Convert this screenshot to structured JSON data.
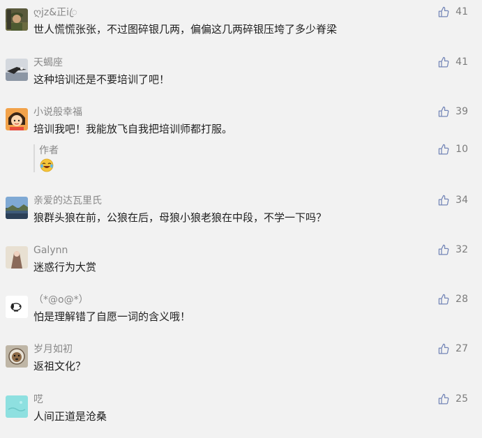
{
  "comments": [
    {
      "name": "ღjz&正iꦿ",
      "text": "世人慌慌张张，不过图碎银几两，偏偏这几两碎银压垮了多少脊梁",
      "likes": "41",
      "avatar": "soldier-avatar"
    },
    {
      "name": "天蝎座",
      "text": "这种培训还是不要培训了吧！",
      "likes": "41",
      "avatar": "eagle-avatar"
    },
    {
      "name": "小说般幸福",
      "text": "培训我吧！我能放飞自我把培训师都打服。",
      "likes": "39",
      "avatar": "cartoon-girl-avatar"
    },
    {
      "name": "亲爱的达瓦里氏",
      "text": "狼群头狼在前，公狼在后，母狼小狼老狼在中段，不学一下吗？",
      "likes": "34",
      "avatar": "landscape-avatar"
    },
    {
      "name": "Galynn",
      "text": "迷惑行为大赏",
      "likes": "32",
      "avatar": "figure-avatar"
    },
    {
      "name": "（*@o@*）",
      "text": "怕是理解错了自愿一词的含义哦！",
      "likes": "28",
      "avatar": "snoopy-avatar"
    },
    {
      "name": "岁月如初",
      "text": "返祖文化？",
      "likes": "27",
      "avatar": "dog-avatar"
    },
    {
      "name": "呓",
      "text": "人间正道是沧桑",
      "likes": "25",
      "avatar": "cyan-avatar"
    }
  ],
  "author_reply": {
    "author": "作者",
    "likes": "10",
    "emoji": "laughing-crying-emoji"
  },
  "colors": {
    "background": "#f2f2f2",
    "name": "#888888",
    "text": "#1f1f1f",
    "like_icon": "#7486b7"
  }
}
